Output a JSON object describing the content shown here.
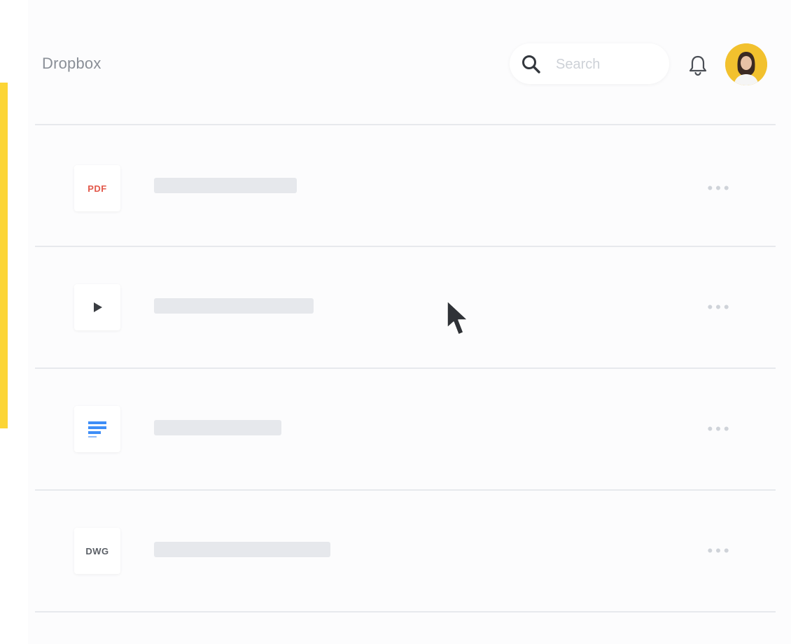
{
  "header": {
    "app_title": "Dropbox",
    "search": {
      "placeholder": "Search",
      "value": ""
    },
    "notification_icon": "bell-icon",
    "avatar_icon": "user-avatar"
  },
  "files": [
    {
      "type_label": "PDF",
      "icon": "pdf-file-icon",
      "label_color": "#e2584a",
      "more_label": "•••"
    },
    {
      "type_label": "",
      "icon": "video-play-icon",
      "label_color": "#3a3d42",
      "more_label": "•••"
    },
    {
      "type_label": "",
      "icon": "document-lines-icon",
      "label_color": "#3e8ef7",
      "more_label": "•••"
    },
    {
      "type_label": "DWG",
      "icon": "dwg-file-icon",
      "label_color": "#5a5f66",
      "more_label": "•••"
    }
  ],
  "colors": {
    "accent": "#fcd535",
    "placeholder_bar": "#e6e8ec",
    "divider": "#e7e9ed",
    "title_text": "#8a8f97"
  },
  "cursor_icon": "mouse-pointer-icon"
}
